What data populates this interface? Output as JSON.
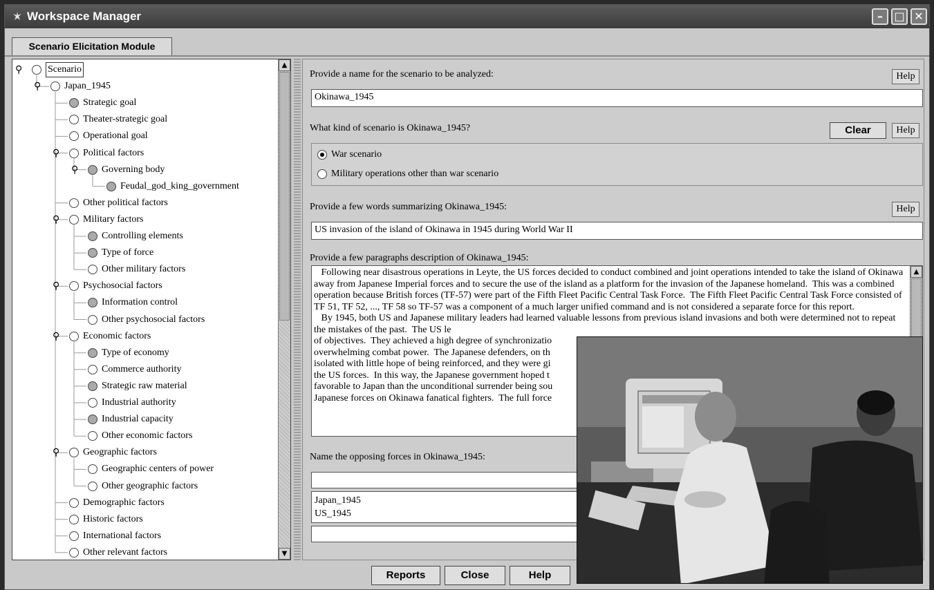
{
  "window": {
    "title": "Workspace Manager"
  },
  "tab": {
    "label": "Scenario Elicitation Module"
  },
  "tree": [
    {
      "label": "Scenario",
      "depth": 0,
      "key": true,
      "filled": false,
      "boxed": true
    },
    {
      "label": "Japan_1945",
      "depth": 1,
      "key": true,
      "filled": false
    },
    {
      "label": "Strategic goal",
      "depth": 2,
      "key": false,
      "filled": true
    },
    {
      "label": "Theater-strategic goal",
      "depth": 2,
      "key": false,
      "filled": false
    },
    {
      "label": "Operational goal",
      "depth": 2,
      "key": false,
      "filled": false
    },
    {
      "label": "Political factors",
      "depth": 2,
      "key": true,
      "filled": false
    },
    {
      "label": "Governing body",
      "depth": 3,
      "key": true,
      "filled": true
    },
    {
      "label": "Feudal_god_king_government",
      "depth": 4,
      "key": false,
      "filled": true
    },
    {
      "label": "Other political factors",
      "depth": 2,
      "key": false,
      "filled": false
    },
    {
      "label": "Military factors",
      "depth": 2,
      "key": true,
      "filled": false
    },
    {
      "label": "Controlling elements",
      "depth": 3,
      "key": false,
      "filled": true
    },
    {
      "label": "Type of force",
      "depth": 3,
      "key": false,
      "filled": true
    },
    {
      "label": "Other military factors",
      "depth": 3,
      "key": false,
      "filled": false
    },
    {
      "label": "Psychosocial factors",
      "depth": 2,
      "key": true,
      "filled": false
    },
    {
      "label": "Information control",
      "depth": 3,
      "key": false,
      "filled": true
    },
    {
      "label": "Other psychosocial factors",
      "depth": 3,
      "key": false,
      "filled": false
    },
    {
      "label": "Economic factors",
      "depth": 2,
      "key": true,
      "filled": false
    },
    {
      "label": "Type of economy",
      "depth": 3,
      "key": false,
      "filled": true
    },
    {
      "label": "Commerce authority",
      "depth": 3,
      "key": false,
      "filled": false
    },
    {
      "label": "Strategic raw material",
      "depth": 3,
      "key": false,
      "filled": true
    },
    {
      "label": "Industrial authority",
      "depth": 3,
      "key": false,
      "filled": false
    },
    {
      "label": "Industrial capacity",
      "depth": 3,
      "key": false,
      "filled": true
    },
    {
      "label": "Other economic factors",
      "depth": 3,
      "key": false,
      "filled": false
    },
    {
      "label": "Geographic factors",
      "depth": 2,
      "key": true,
      "filled": false
    },
    {
      "label": "Geographic centers of power",
      "depth": 3,
      "key": false,
      "filled": false
    },
    {
      "label": "Other geographic factors",
      "depth": 3,
      "key": false,
      "filled": false
    },
    {
      "label": "Demographic factors",
      "depth": 2,
      "key": false,
      "filled": false
    },
    {
      "label": "Historic factors",
      "depth": 2,
      "key": false,
      "filled": false
    },
    {
      "label": "International factors",
      "depth": 2,
      "key": false,
      "filled": false
    },
    {
      "label": "Other relevant factors",
      "depth": 2,
      "key": false,
      "filled": false
    }
  ],
  "form": {
    "name_prompt": "Provide a name for the scenario to be analyzed:",
    "name_value": "Okinawa_1945",
    "kind_prompt": "What kind of scenario is Okinawa_1945?",
    "radio_war": "War scenario",
    "radio_other": "Military operations other than war scenario",
    "summary_prompt": "Provide a few words summarizing Okinawa_1945:",
    "summary_value": "US invasion of the island of Okinawa in 1945 during World War II",
    "desc_prompt": "Provide a few paragraphs description of Okinawa_1945:",
    "desc_value": "   Following near disastrous operations in Leyte, the US forces decided to conduct combined and joint operations intended to take the island of Okinawa away from Japanese Imperial forces and to secure the use of the island as a platform for the invasion of the Japanese homeland.  This was a combined operation because British forces (TF-57) were part of the Fifth Fleet Pacific Central Task Force.  The Fifth Fleet Pacific Central Task Force consisted of TF 51, TF 52, ..., TF 58 so TF-57 was a component of a much larger unified command and is not considered a separate force for this report.\n   By 1945, both US and Japanese military leaders had learned valuable lessons from previous island invasions and both were determined not to repeat the mistakes of the past.  The US le\nof objectives.  They achieved a high degree of synchronizatio\noverwhelming combat power.  The Japanese defenders, on th\nisolated with little hope of being reinforced, and they were gi\nthe US forces.  In this way, the Japanese government hoped t\nfavorable to Japan than the unconditional surrender being sou\nJapanese forces on Okinawa fanatical fighters.  The full force",
    "opposing_prompt": "Name the opposing forces in Okinawa_1945:",
    "forces": [
      "Japan_1945",
      "US_1945"
    ],
    "help": "Help",
    "clear": "Clear"
  },
  "buttons": {
    "reports": "Reports",
    "close": "Close",
    "help": "Help"
  }
}
